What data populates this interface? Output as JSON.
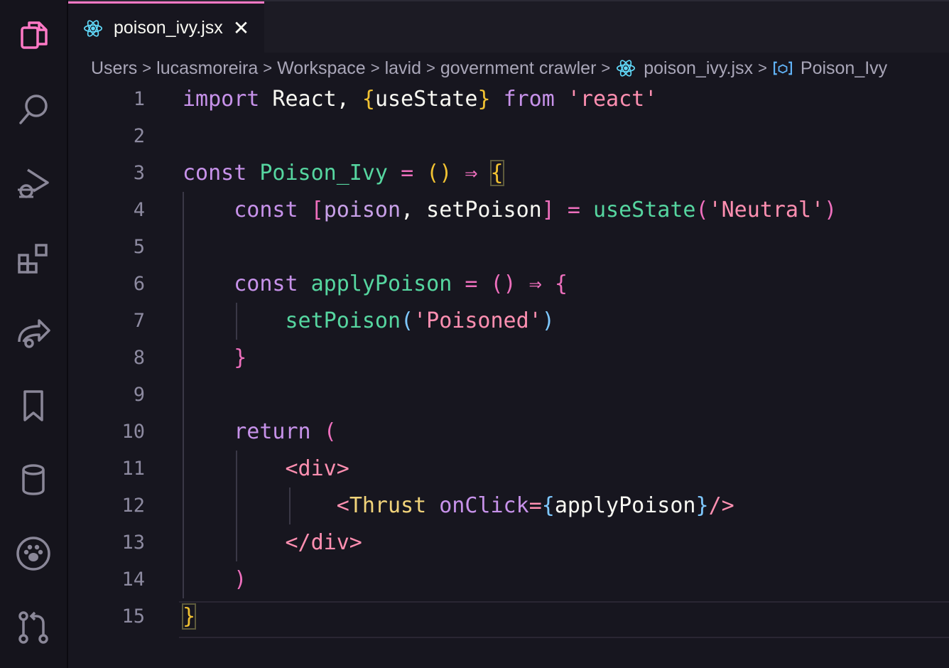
{
  "activity_bar": {
    "icons": [
      "files-icon",
      "search-icon",
      "run-debug-icon",
      "extensions-icon",
      "remote-share-icon",
      "bookmark-icon",
      "database-icon",
      "paw-icon",
      "source-control-icon"
    ]
  },
  "tab": {
    "label": "poison_ivy.jsx",
    "close": "✕"
  },
  "breadcrumb": {
    "items": [
      "Users",
      "lucasmoreira",
      "Workspace",
      "lavid",
      "government crawler",
      "poison_ivy.jsx",
      "Poison_Ivy"
    ],
    "separator": ">"
  },
  "editor": {
    "line_numbers": [
      "1",
      "2",
      "3",
      "4",
      "5",
      "6",
      "7",
      "8",
      "9",
      "10",
      "11",
      "12",
      "13",
      "14",
      "15"
    ],
    "lines": [
      [
        [
          "k",
          "import"
        ],
        [
          "w",
          " React, "
        ],
        [
          "y",
          "{"
        ],
        [
          "w",
          "useState"
        ],
        [
          "y",
          "}"
        ],
        [
          "w",
          " "
        ],
        [
          "k",
          "from"
        ],
        [
          "w",
          " "
        ],
        [
          "s",
          "'react'"
        ]
      ],
      [],
      [
        [
          "k",
          "const"
        ],
        [
          "w",
          " "
        ],
        [
          "f",
          "Poison_Ivy"
        ],
        [
          "w",
          " "
        ],
        [
          "p",
          "="
        ],
        [
          "w",
          " "
        ],
        [
          "y",
          "()"
        ],
        [
          "w",
          " "
        ],
        [
          "p",
          "⇒"
        ],
        [
          "w",
          " "
        ],
        [
          "ybox",
          "{"
        ]
      ],
      [
        [
          "w",
          "    "
        ],
        [
          "k",
          "const"
        ],
        [
          "w",
          " "
        ],
        [
          "p",
          "["
        ],
        [
          "v",
          "poison"
        ],
        [
          "w",
          ", setPoison"
        ],
        [
          "p",
          "]"
        ],
        [
          "w",
          " "
        ],
        [
          "p",
          "="
        ],
        [
          "w",
          " "
        ],
        [
          "f",
          "useState"
        ],
        [
          "p",
          "("
        ],
        [
          "s",
          "'Neutral'"
        ],
        [
          "p",
          ")"
        ]
      ],
      [],
      [
        [
          "w",
          "    "
        ],
        [
          "k",
          "const"
        ],
        [
          "w",
          " "
        ],
        [
          "f",
          "applyPoison"
        ],
        [
          "w",
          " "
        ],
        [
          "p",
          "="
        ],
        [
          "w",
          " "
        ],
        [
          "p",
          "()"
        ],
        [
          "w",
          " "
        ],
        [
          "p",
          "⇒"
        ],
        [
          "w",
          " "
        ],
        [
          "p",
          "{"
        ]
      ],
      [
        [
          "w",
          "        "
        ],
        [
          "f",
          "setPoison"
        ],
        [
          "c",
          "("
        ],
        [
          "s",
          "'Poisoned'"
        ],
        [
          "c",
          ")"
        ]
      ],
      [
        [
          "w",
          "    "
        ],
        [
          "p",
          "}"
        ]
      ],
      [],
      [
        [
          "w",
          "    "
        ],
        [
          "k",
          "return"
        ],
        [
          "w",
          " "
        ],
        [
          "p",
          "("
        ]
      ],
      [
        [
          "w",
          "        "
        ],
        [
          "tag",
          "<div>"
        ]
      ],
      [
        [
          "w",
          "            "
        ],
        [
          "tag",
          "<"
        ],
        [
          "comp",
          "Thrust"
        ],
        [
          "w",
          " "
        ],
        [
          "attr",
          "onClick"
        ],
        [
          "tag",
          "="
        ],
        [
          "c",
          "{"
        ],
        [
          "w",
          "applyPoison"
        ],
        [
          "c",
          "}"
        ],
        [
          "tag",
          "/>"
        ]
      ],
      [
        [
          "w",
          "        "
        ],
        [
          "tag",
          "</div>"
        ]
      ],
      [
        [
          "w",
          "    "
        ],
        [
          "p",
          ")"
        ]
      ],
      [
        [
          "ybox",
          "}"
        ]
      ]
    ]
  }
}
